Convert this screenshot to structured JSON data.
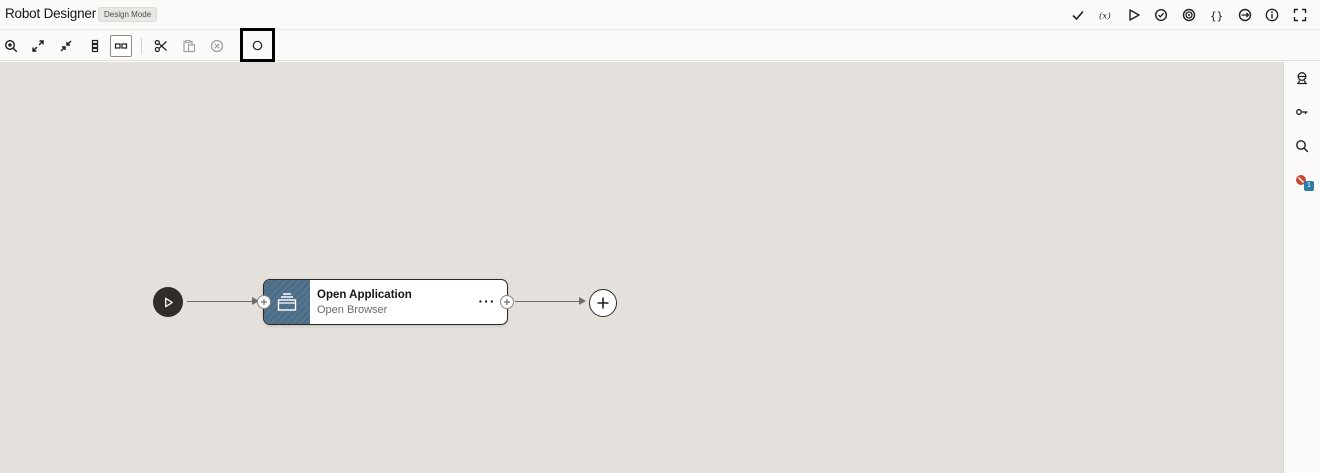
{
  "header": {
    "title": "Robot Designer",
    "mode_badge": "Design Mode",
    "actions": [
      "validate-icon",
      "variables-icon",
      "run-icon",
      "settings-check-icon",
      "target-icon",
      "braces-icon",
      "connection-icon",
      "info-icon",
      "fullscreen-icon"
    ]
  },
  "toolbar": {
    "tools": [
      "zoom-in-icon",
      "expand-icon",
      "collapse-icon",
      "vertical-layout-icon",
      "horizontal-layout-icon",
      "cut-icon",
      "paste-icon",
      "remove-icon",
      "circle-icon"
    ]
  },
  "flow": {
    "node": {
      "title": "Open Application",
      "subtitle": "Open Browser",
      "menu": "···"
    }
  },
  "right_panel": {
    "error_count": "1"
  }
}
